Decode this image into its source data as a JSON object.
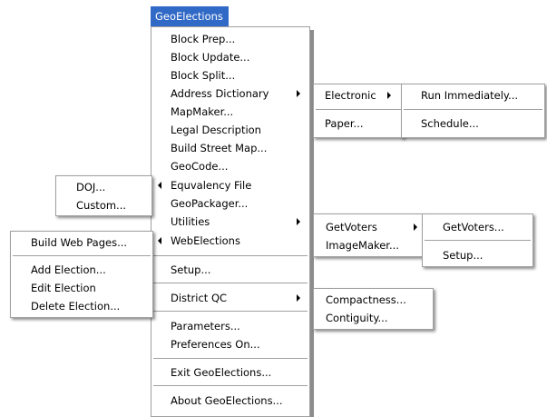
{
  "menu_title": "GeoElections",
  "main_menu": {
    "items": [
      {
        "label": "Block Prep..."
      },
      {
        "label": "Block Update..."
      },
      {
        "label": "Block Split..."
      },
      {
        "label": "Address Dictionary"
      },
      {
        "label": "MapMaker..."
      },
      {
        "label": "Legal Description"
      },
      {
        "label": "Build Street Map..."
      },
      {
        "label": "GeoCode..."
      },
      {
        "label": "Equvalency File"
      },
      {
        "label": "GeoPackager..."
      },
      {
        "label": "Utilities"
      },
      {
        "label": "WebElections"
      },
      {
        "label": "Setup..."
      },
      {
        "label": "District QC"
      },
      {
        "label": "Parameters..."
      },
      {
        "label": "Preferences On..."
      },
      {
        "label": "Exit GeoElections..."
      },
      {
        "label": "About GeoElections..."
      }
    ]
  },
  "address_submenu": {
    "items": [
      {
        "label": "Electronic"
      },
      {
        "label": "Paper..."
      }
    ]
  },
  "electronic_submenu": {
    "items": [
      {
        "label": "Run Immediately..."
      },
      {
        "label": "Schedule..."
      }
    ]
  },
  "equivalency_submenu": {
    "items": [
      {
        "label": "DOJ..."
      },
      {
        "label": "Custom..."
      }
    ]
  },
  "utilities_submenu": {
    "items": [
      {
        "label": "GetVoters"
      },
      {
        "label": "ImageMaker..."
      }
    ]
  },
  "getvoters_submenu": {
    "items": [
      {
        "label": "GetVoters..."
      },
      {
        "label": "Setup..."
      }
    ]
  },
  "webelections_submenu": {
    "items": [
      {
        "label": "Build Web Pages..."
      },
      {
        "label": "Add Election..."
      },
      {
        "label": "Edit Election"
      },
      {
        "label": "Delete Election..."
      }
    ]
  },
  "districtqc_submenu": {
    "items": [
      {
        "label": "Compactness..."
      },
      {
        "label": "Contiguity..."
      }
    ]
  }
}
